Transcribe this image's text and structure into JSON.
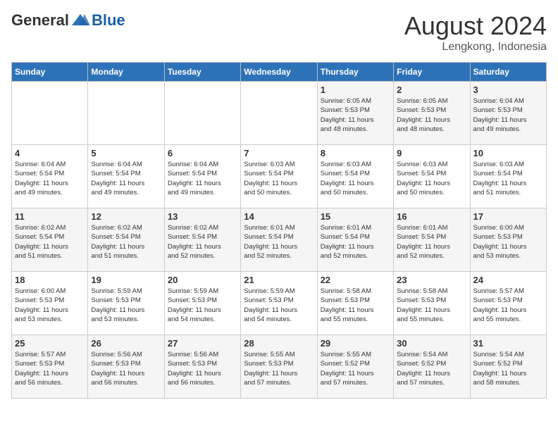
{
  "header": {
    "logo": {
      "general": "General",
      "blue": "Blue"
    },
    "month_year": "August 2024",
    "location": "Lengkong, Indonesia"
  },
  "weekdays": [
    "Sunday",
    "Monday",
    "Tuesday",
    "Wednesday",
    "Thursday",
    "Friday",
    "Saturday"
  ],
  "weeks": [
    [
      {
        "day": "",
        "info": ""
      },
      {
        "day": "",
        "info": ""
      },
      {
        "day": "",
        "info": ""
      },
      {
        "day": "",
        "info": ""
      },
      {
        "day": "1",
        "info": "Sunrise: 6:05 AM\nSunset: 5:53 PM\nDaylight: 11 hours\nand 48 minutes."
      },
      {
        "day": "2",
        "info": "Sunrise: 6:05 AM\nSunset: 5:53 PM\nDaylight: 11 hours\nand 48 minutes."
      },
      {
        "day": "3",
        "info": "Sunrise: 6:04 AM\nSunset: 5:53 PM\nDaylight: 11 hours\nand 49 minutes."
      }
    ],
    [
      {
        "day": "4",
        "info": "Sunrise: 6:04 AM\nSunset: 5:54 PM\nDaylight: 11 hours\nand 49 minutes."
      },
      {
        "day": "5",
        "info": "Sunrise: 6:04 AM\nSunset: 5:54 PM\nDaylight: 11 hours\nand 49 minutes."
      },
      {
        "day": "6",
        "info": "Sunrise: 6:04 AM\nSunset: 5:54 PM\nDaylight: 11 hours\nand 49 minutes."
      },
      {
        "day": "7",
        "info": "Sunrise: 6:03 AM\nSunset: 5:54 PM\nDaylight: 11 hours\nand 50 minutes."
      },
      {
        "day": "8",
        "info": "Sunrise: 6:03 AM\nSunset: 5:54 PM\nDaylight: 11 hours\nand 50 minutes."
      },
      {
        "day": "9",
        "info": "Sunrise: 6:03 AM\nSunset: 5:54 PM\nDaylight: 11 hours\nand 50 minutes."
      },
      {
        "day": "10",
        "info": "Sunrise: 6:03 AM\nSunset: 5:54 PM\nDaylight: 11 hours\nand 51 minutes."
      }
    ],
    [
      {
        "day": "11",
        "info": "Sunrise: 6:02 AM\nSunset: 5:54 PM\nDaylight: 11 hours\nand 51 minutes."
      },
      {
        "day": "12",
        "info": "Sunrise: 6:02 AM\nSunset: 5:54 PM\nDaylight: 11 hours\nand 51 minutes."
      },
      {
        "day": "13",
        "info": "Sunrise: 6:02 AM\nSunset: 5:54 PM\nDaylight: 11 hours\nand 52 minutes."
      },
      {
        "day": "14",
        "info": "Sunrise: 6:01 AM\nSunset: 5:54 PM\nDaylight: 11 hours\nand 52 minutes."
      },
      {
        "day": "15",
        "info": "Sunrise: 6:01 AM\nSunset: 5:54 PM\nDaylight: 11 hours\nand 52 minutes."
      },
      {
        "day": "16",
        "info": "Sunrise: 6:01 AM\nSunset: 5:54 PM\nDaylight: 11 hours\nand 52 minutes."
      },
      {
        "day": "17",
        "info": "Sunrise: 6:00 AM\nSunset: 5:53 PM\nDaylight: 11 hours\nand 53 minutes."
      }
    ],
    [
      {
        "day": "18",
        "info": "Sunrise: 6:00 AM\nSunset: 5:53 PM\nDaylight: 11 hours\nand 53 minutes."
      },
      {
        "day": "19",
        "info": "Sunrise: 5:59 AM\nSunset: 5:53 PM\nDaylight: 11 hours\nand 53 minutes."
      },
      {
        "day": "20",
        "info": "Sunrise: 5:59 AM\nSunset: 5:53 PM\nDaylight: 11 hours\nand 54 minutes."
      },
      {
        "day": "21",
        "info": "Sunrise: 5:59 AM\nSunset: 5:53 PM\nDaylight: 11 hours\nand 54 minutes."
      },
      {
        "day": "22",
        "info": "Sunrise: 5:58 AM\nSunset: 5:53 PM\nDaylight: 11 hours\nand 55 minutes."
      },
      {
        "day": "23",
        "info": "Sunrise: 5:58 AM\nSunset: 5:53 PM\nDaylight: 11 hours\nand 55 minutes."
      },
      {
        "day": "24",
        "info": "Sunrise: 5:57 AM\nSunset: 5:53 PM\nDaylight: 11 hours\nand 55 minutes."
      }
    ],
    [
      {
        "day": "25",
        "info": "Sunrise: 5:57 AM\nSunset: 5:53 PM\nDaylight: 11 hours\nand 56 minutes."
      },
      {
        "day": "26",
        "info": "Sunrise: 5:56 AM\nSunset: 5:53 PM\nDaylight: 11 hours\nand 56 minutes."
      },
      {
        "day": "27",
        "info": "Sunrise: 5:56 AM\nSunset: 5:53 PM\nDaylight: 11 hours\nand 56 minutes."
      },
      {
        "day": "28",
        "info": "Sunrise: 5:55 AM\nSunset: 5:53 PM\nDaylight: 11 hours\nand 57 minutes."
      },
      {
        "day": "29",
        "info": "Sunrise: 5:55 AM\nSunset: 5:52 PM\nDaylight: 11 hours\nand 57 minutes."
      },
      {
        "day": "30",
        "info": "Sunrise: 5:54 AM\nSunset: 5:52 PM\nDaylight: 11 hours\nand 57 minutes."
      },
      {
        "day": "31",
        "info": "Sunrise: 5:54 AM\nSunset: 5:52 PM\nDaylight: 11 hours\nand 58 minutes."
      }
    ]
  ]
}
